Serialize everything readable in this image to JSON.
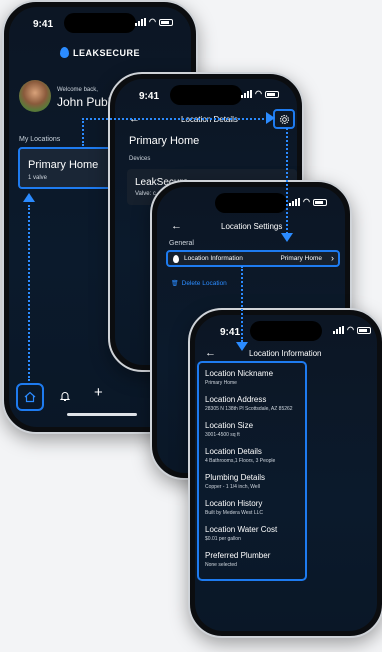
{
  "status": {
    "time": "9:41"
  },
  "phone1": {
    "logo_text": "LEAKSECURE",
    "welcome": "Welcome back,",
    "user_name": "John Public",
    "section_label": "My Locations",
    "location_name": "Primary Home",
    "location_sub": "1 valve",
    "nav": [
      "home-icon",
      "bell-icon",
      "plus-icon"
    ]
  },
  "phone2": {
    "header_title": "Location Details",
    "location_name": "Primary Home",
    "section_label": "Devices",
    "device_name": "LeakSecure",
    "device_sub": "Valve: c"
  },
  "phone3": {
    "header_title": "Location Settings",
    "section_label": "General",
    "row_label": "Location Information",
    "row_value": "Primary Home",
    "delete_label": "Delete Location"
  },
  "phone4": {
    "header_title": "Location Information",
    "fields": [
      {
        "label": "Location Nickname",
        "value": "Primary Home"
      },
      {
        "label": "Location Address",
        "value": "28305 N 138th Pl Scottsdale, AZ 85262"
      },
      {
        "label": "Location Size",
        "value": "3001-4500 sq ft"
      },
      {
        "label": "Location Details",
        "value": "4 Bathrooms,1 Floors, 3 People"
      },
      {
        "label": "Plumbing Details",
        "value": "Copper - 1 1/4 inch, Well"
      },
      {
        "label": "Location History",
        "value": "Built by Medera West LLC"
      },
      {
        "label": "Location Water Cost",
        "value": "$0.01 per gallon"
      },
      {
        "label": "Preferred Plumber",
        "value": "None selected"
      }
    ]
  },
  "colors": {
    "accent": "#1e7bf0",
    "background": "#0b1a2c"
  }
}
